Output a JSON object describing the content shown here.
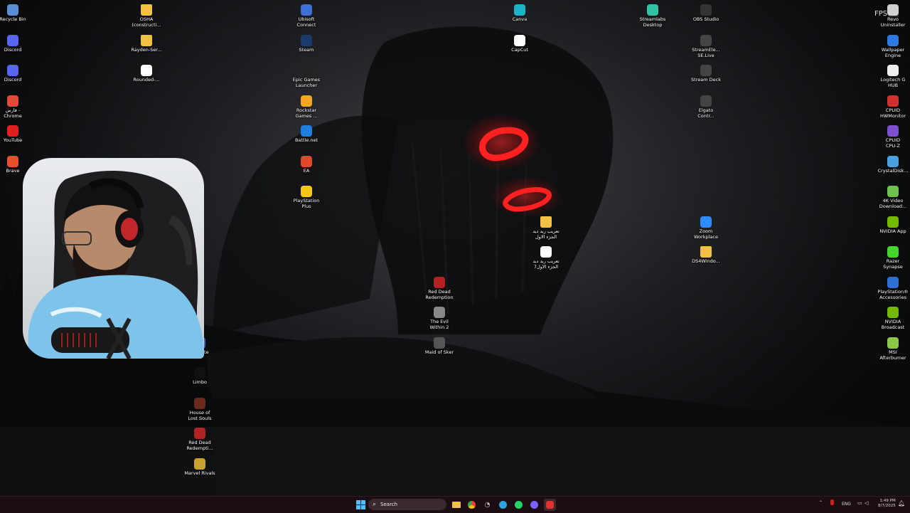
{
  "desktop": {
    "fps_label": "FPS",
    "icons": [
      {
        "name": "recycle-bin",
        "label": "Recycle Bin",
        "color": "#5a8fd8"
      },
      {
        "name": "discord-1",
        "label": "Discord",
        "color": "#5865f2"
      },
      {
        "name": "discord-2",
        "label": "Discord",
        "color": "#5865f2"
      },
      {
        "name": "chrome-fares",
        "label": "فارس -\nChrome",
        "color": "#e04b3a"
      },
      {
        "name": "youtube",
        "label": "YouTube",
        "color": "#e02020"
      },
      {
        "name": "brave",
        "label": "Brave",
        "color": "#e4502c"
      },
      {
        "name": "osha",
        "label": "OSHA\n(constructi...",
        "color": "#f2c043"
      },
      {
        "name": "rayden-ser",
        "label": "Rayden-Ser...",
        "color": "#f2c043"
      },
      {
        "name": "rounded",
        "label": "Rounded-...",
        "color": "#ffffff"
      },
      {
        "name": "ubisoft",
        "label": "Ubisoft\nConnect",
        "color": "#3d6fd6"
      },
      {
        "name": "steam",
        "label": "Steam",
        "color": "#1b3b6f"
      },
      {
        "name": "epic",
        "label": "Epic Games\nLauncher",
        "color": "#222222"
      },
      {
        "name": "rockstar",
        "label": "Rockstar\nGames ...",
        "color": "#f5a623"
      },
      {
        "name": "battlenet",
        "label": "Battle.net",
        "color": "#1e7fe0"
      },
      {
        "name": "ea",
        "label": "EA",
        "color": "#e0472b"
      },
      {
        "name": "playstation-plus",
        "label": "PlayStation\nPlus",
        "color": "#f5c518"
      },
      {
        "name": "canva",
        "label": "Canva",
        "color": "#1db4c9"
      },
      {
        "name": "capcut",
        "label": "CapCut",
        "color": "#ffffff"
      },
      {
        "name": "streamlabs",
        "label": "Streamlabs\nDesktop",
        "color": "#31c3a2"
      },
      {
        "name": "obs",
        "label": "OBS Studio",
        "color": "#333333"
      },
      {
        "name": "streamelements",
        "label": "StreamEle...\nSE.Live",
        "color": "#444444"
      },
      {
        "name": "streamdeck",
        "label": "Stream Deck",
        "color": "#444444"
      },
      {
        "name": "elgato",
        "label": "Elgato\nContr...",
        "color": "#444444"
      },
      {
        "name": "revo",
        "label": "Revo\nUninstaller",
        "color": "#d0d0d0"
      },
      {
        "name": "wallpaper-engine",
        "label": "Wallpaper\nEngine",
        "color": "#2d7be0"
      },
      {
        "name": "logitech",
        "label": "Logitech G\nHUB",
        "color": "#eeeeee"
      },
      {
        "name": "cpuid-hw",
        "label": "CPUID\nHWMonitor",
        "color": "#d03030"
      },
      {
        "name": "cpuid-cpuz",
        "label": "CPUID\nCPU-Z",
        "color": "#7a4fd0"
      },
      {
        "name": "crystaldisk",
        "label": "CrystalDisk...",
        "color": "#4aa0e0"
      },
      {
        "name": "4k-video",
        "label": "4K Video\nDownload...",
        "color": "#6cc24a"
      },
      {
        "name": "nvidia-app",
        "label": "NVIDIA App",
        "color": "#76b900"
      },
      {
        "name": "razer",
        "label": "Razer\nSynapse",
        "color": "#44d62c"
      },
      {
        "name": "ps-accessories",
        "label": "PlayStation®\nAccessories",
        "color": "#2d6fd6"
      },
      {
        "name": "nvidia-broadcast",
        "label": "NVIDIA\nBroadcast",
        "color": "#76b900"
      },
      {
        "name": "msi-afterburner",
        "label": "MSI\nAfterburner",
        "color": "#8ac84a"
      },
      {
        "name": "zoom",
        "label": "Zoom\nWorkplace",
        "color": "#2d8cff"
      },
      {
        "name": "ds4windows",
        "label": "DS4Windo...",
        "color": "#f2c043"
      },
      {
        "name": "arabic-folder",
        "label": "تعريب ريد ديد\nالجزء الاول",
        "color": "#f2c043"
      },
      {
        "name": "arabic-file",
        "label": "تعريب ريد ديد\n7الجزء الاول",
        "color": "#ffffff"
      },
      {
        "name": "rdr",
        "label": "Red Dead\nRedemption",
        "color": "#b22222"
      },
      {
        "name": "evil-within",
        "label": "The Evil\nWithin 2",
        "color": "#888888"
      },
      {
        "name": "maid-of-sker",
        "label": "Maid of Sker",
        "color": "#555555"
      },
      {
        "name": "fortnite",
        "label": "Fortnite",
        "color": "#2a6fd6"
      },
      {
        "name": "limbo",
        "label": "Limbo",
        "color": "#111111"
      },
      {
        "name": "house-lost-souls",
        "label": "House of\nLost Souls",
        "color": "#6a2a1a"
      },
      {
        "name": "rdr-2",
        "label": "Red Dead\nRedempti...",
        "color": "#b22222"
      },
      {
        "name": "marvel-rivals",
        "label": "Marvel Rivals",
        "color": "#c8a030"
      }
    ]
  },
  "taskbar": {
    "search_placeholder": "Search",
    "language": "ENG",
    "time": "1:49 PM",
    "date": "8/7/2025"
  }
}
